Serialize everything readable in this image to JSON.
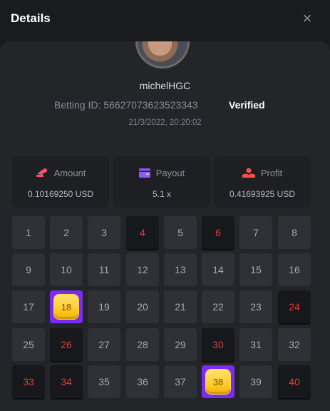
{
  "header": {
    "title": "Details",
    "close_label": "×"
  },
  "user": {
    "name": "michelHGC",
    "betting_id": "Betting ID: 56627073623523343",
    "verified": "Verified",
    "datetime": "21/3/2022, 20:20:02"
  },
  "stats": [
    {
      "label": "Amount",
      "value": "0.10169250 USD",
      "icon": "coins-icon",
      "color": "#ff4d6d"
    },
    {
      "label": "Payout",
      "value": "5.1 x",
      "icon": "wallet-icon",
      "color": "#8b5cf6"
    },
    {
      "label": "Profit",
      "value": "0.41693925 USD",
      "icon": "hand-coin-icon",
      "color": "#ff4d4d"
    }
  ],
  "tiles": [
    {
      "n": "1",
      "state": "normal"
    },
    {
      "n": "2",
      "state": "normal"
    },
    {
      "n": "3",
      "state": "normal"
    },
    {
      "n": "4",
      "state": "hit"
    },
    {
      "n": "5",
      "state": "normal"
    },
    {
      "n": "6",
      "state": "hit"
    },
    {
      "n": "7",
      "state": "normal"
    },
    {
      "n": "8",
      "state": "normal"
    },
    {
      "n": "9",
      "state": "normal"
    },
    {
      "n": "10",
      "state": "normal"
    },
    {
      "n": "11",
      "state": "normal"
    },
    {
      "n": "12",
      "state": "normal"
    },
    {
      "n": "13",
      "state": "normal"
    },
    {
      "n": "14",
      "state": "normal"
    },
    {
      "n": "15",
      "state": "normal"
    },
    {
      "n": "16",
      "state": "normal"
    },
    {
      "n": "17",
      "state": "normal"
    },
    {
      "n": "18",
      "state": "win"
    },
    {
      "n": "19",
      "state": "normal"
    },
    {
      "n": "20",
      "state": "normal"
    },
    {
      "n": "21",
      "state": "normal"
    },
    {
      "n": "22",
      "state": "normal"
    },
    {
      "n": "23",
      "state": "normal"
    },
    {
      "n": "24",
      "state": "hit"
    },
    {
      "n": "25",
      "state": "normal"
    },
    {
      "n": "26",
      "state": "hit"
    },
    {
      "n": "27",
      "state": "normal"
    },
    {
      "n": "28",
      "state": "normal"
    },
    {
      "n": "29",
      "state": "normal"
    },
    {
      "n": "30",
      "state": "hit"
    },
    {
      "n": "31",
      "state": "normal"
    },
    {
      "n": "32",
      "state": "normal"
    },
    {
      "n": "33",
      "state": "hit"
    },
    {
      "n": "34",
      "state": "hit"
    },
    {
      "n": "35",
      "state": "normal"
    },
    {
      "n": "36",
      "state": "normal"
    },
    {
      "n": "37",
      "state": "normal"
    },
    {
      "n": "38",
      "state": "win"
    },
    {
      "n": "39",
      "state": "normal"
    },
    {
      "n": "40",
      "state": "hit"
    }
  ]
}
